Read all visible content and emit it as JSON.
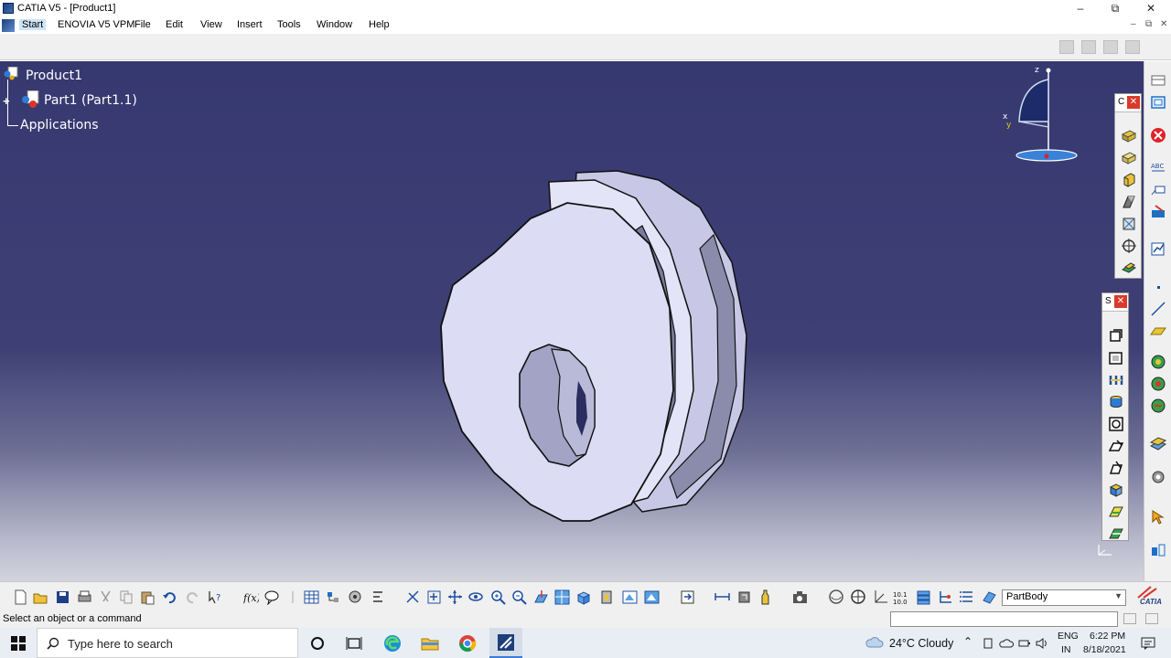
{
  "window": {
    "title": "CATIA V5 - [Product1]"
  },
  "menubar": {
    "items": [
      "Start",
      "ENOVIA V5 VPM",
      "File",
      "Edit",
      "View",
      "Insert",
      "Tools",
      "Window",
      "Help"
    ]
  },
  "tree": {
    "root": "Product1",
    "child": "Part1 (Part1.1)",
    "applications": "Applications"
  },
  "compass": {
    "x_label": "x",
    "y_label": "y",
    "z_label": "z"
  },
  "palettes": {
    "top": {
      "title": "C"
    },
    "bottom": {
      "title": "S"
    }
  },
  "bottom_toolbar": {
    "workbench_value": "PartBody",
    "catia_logo": "CATIA"
  },
  "status": {
    "message": "Select an object or a command"
  },
  "taskbar": {
    "search_placeholder": "Type here to search",
    "weather": "24°C  Cloudy",
    "language": "ENG",
    "region": "IN",
    "time": "6:22 PM",
    "date": "8/18/2021"
  },
  "colors": {
    "viewport_top": "#363870",
    "viewport_bottom": "#d4d4de",
    "part_face": "#dcdcf5",
    "part_side": "#a3a3c6",
    "close_red": "#d93a2b"
  }
}
